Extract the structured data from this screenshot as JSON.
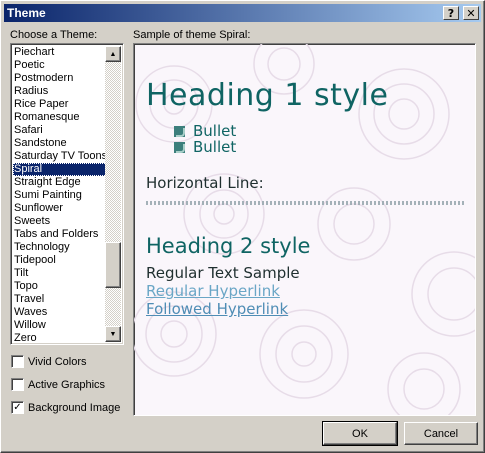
{
  "window": {
    "title": "Theme"
  },
  "titlebar": {
    "help_glyph": "?",
    "close_glyph": "✕"
  },
  "labels": {
    "choose_theme": "Choose a Theme:",
    "sample": "Sample of theme Spiral:"
  },
  "theme_list": {
    "items": [
      "Piechart",
      "Poetic",
      "Postmodern",
      "Radius",
      "Rice Paper",
      "Romanesque",
      "Safari",
      "Sandstone",
      "Saturday TV Toons",
      "Spiral",
      "Straight Edge",
      "Sumi Painting",
      "Sunflower",
      "Sweets",
      "Tabs and Folders",
      "Technology",
      "Tidepool",
      "Tilt",
      "Topo",
      "Travel",
      "Waves",
      "Willow",
      "Zero"
    ],
    "selected": "Spiral",
    "selected_fraction_scroll": 0.8
  },
  "options": {
    "vivid_colors": {
      "label": "Vivid Colors",
      "checked": false
    },
    "active_graphics": {
      "label": "Active Graphics",
      "checked": false
    },
    "background_image": {
      "label": "Background Image",
      "checked": true
    }
  },
  "preview": {
    "heading1": "Heading 1 style",
    "bullets": [
      "Bullet",
      "Bullet"
    ],
    "horizontal_line_label": "Horizontal Line:",
    "heading2": "Heading 2 style",
    "regular_text": "Regular Text Sample",
    "regular_hyperlink": "Regular Hyperlink",
    "followed_hyperlink": "Followed Hyperlink"
  },
  "buttons": {
    "ok": "OK",
    "cancel": "Cancel"
  },
  "colors": {
    "titlebar": "#0a246a",
    "selection": "#0a246a",
    "theme_text": "#0f6463",
    "link": "#6aa6c6"
  }
}
